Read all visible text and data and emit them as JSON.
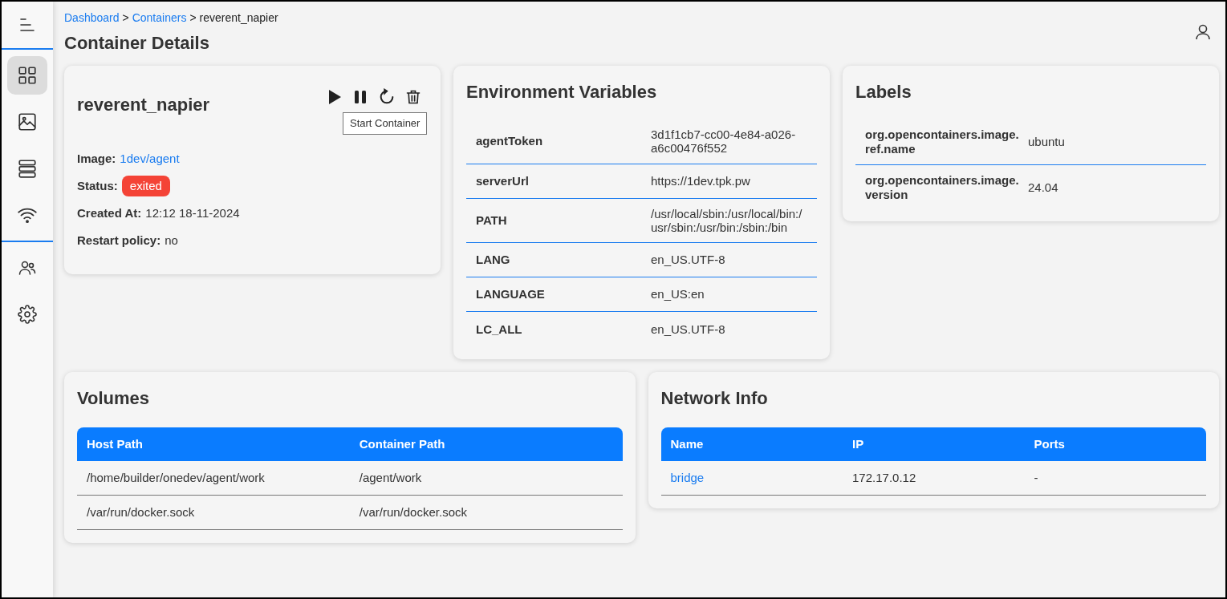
{
  "sidebar": {
    "groups": [
      {
        "items": [
          {
            "selected": true
          },
          {
            "selected": false
          },
          {
            "selected": false
          },
          {
            "selected": false
          }
        ]
      },
      {
        "items": [
          {
            "selected": false
          },
          {
            "selected": false
          }
        ]
      }
    ]
  },
  "breadcrumb": [
    {
      "label": "Dashboard",
      "kind": "link"
    },
    {
      "label": ">",
      "kind": "separator"
    },
    {
      "label": "Containers",
      "kind": "link"
    },
    {
      "label": ">",
      "kind": "separator"
    },
    {
      "label": "reverent_napier",
      "kind": "current"
    }
  ],
  "page_title": "Container Details",
  "container": {
    "name": "reverent_napier",
    "tooltip": "Start Container",
    "fields": [
      {
        "label": "Image:",
        "value": "1dev/agent",
        "kind": "link"
      },
      {
        "label": "Status:",
        "value": "exited",
        "kind": "badge",
        "color": "#f44336"
      },
      {
        "label": "Created At:",
        "value": "12:12 18-11-2024",
        "kind": "text"
      },
      {
        "label": "Restart policy:",
        "value": "no",
        "kind": "text"
      }
    ]
  },
  "environment": {
    "title": "Environment Variables",
    "rows": [
      {
        "name": "agentToken",
        "value": "3d1f1cb7-cc00-4e84-a026-a6c00476f552"
      },
      {
        "name": "serverUrl",
        "value": "https://1dev.tpk.pw"
      },
      {
        "name": "PATH",
        "value": "/usr/local/sbin:/usr/local/bin:/usr/sbin:/usr/bin:/sbin:/bin"
      },
      {
        "name": "LANG",
        "value": "en_US.UTF-8"
      },
      {
        "name": "LANGUAGE",
        "value": "en_US:en"
      },
      {
        "name": "LC_ALL",
        "value": "en_US.UTF-8"
      }
    ]
  },
  "labels": {
    "title": "Labels",
    "rows": [
      {
        "name": "org.opencontainers.image.ref.name",
        "value": "ubuntu"
      },
      {
        "name": "org.opencontainers.image.version",
        "value": "24.04"
      }
    ]
  },
  "volumes": {
    "title": "Volumes",
    "columns": [
      "Host Path",
      "Container Path"
    ],
    "rows": [
      [
        "/home/builder/onedev/agent/work",
        "/agent/work"
      ],
      [
        "/var/run/docker.sock",
        "/var/run/docker.sock"
      ]
    ]
  },
  "network": {
    "title": "Network Info",
    "columns": [
      "Name",
      "IP",
      "Ports"
    ],
    "rows": [
      [
        {
          "text": "bridge",
          "kind": "link"
        },
        {
          "text": "172.17.0.12",
          "kind": "text"
        },
        {
          "text": "-",
          "kind": "text"
        }
      ]
    ]
  }
}
